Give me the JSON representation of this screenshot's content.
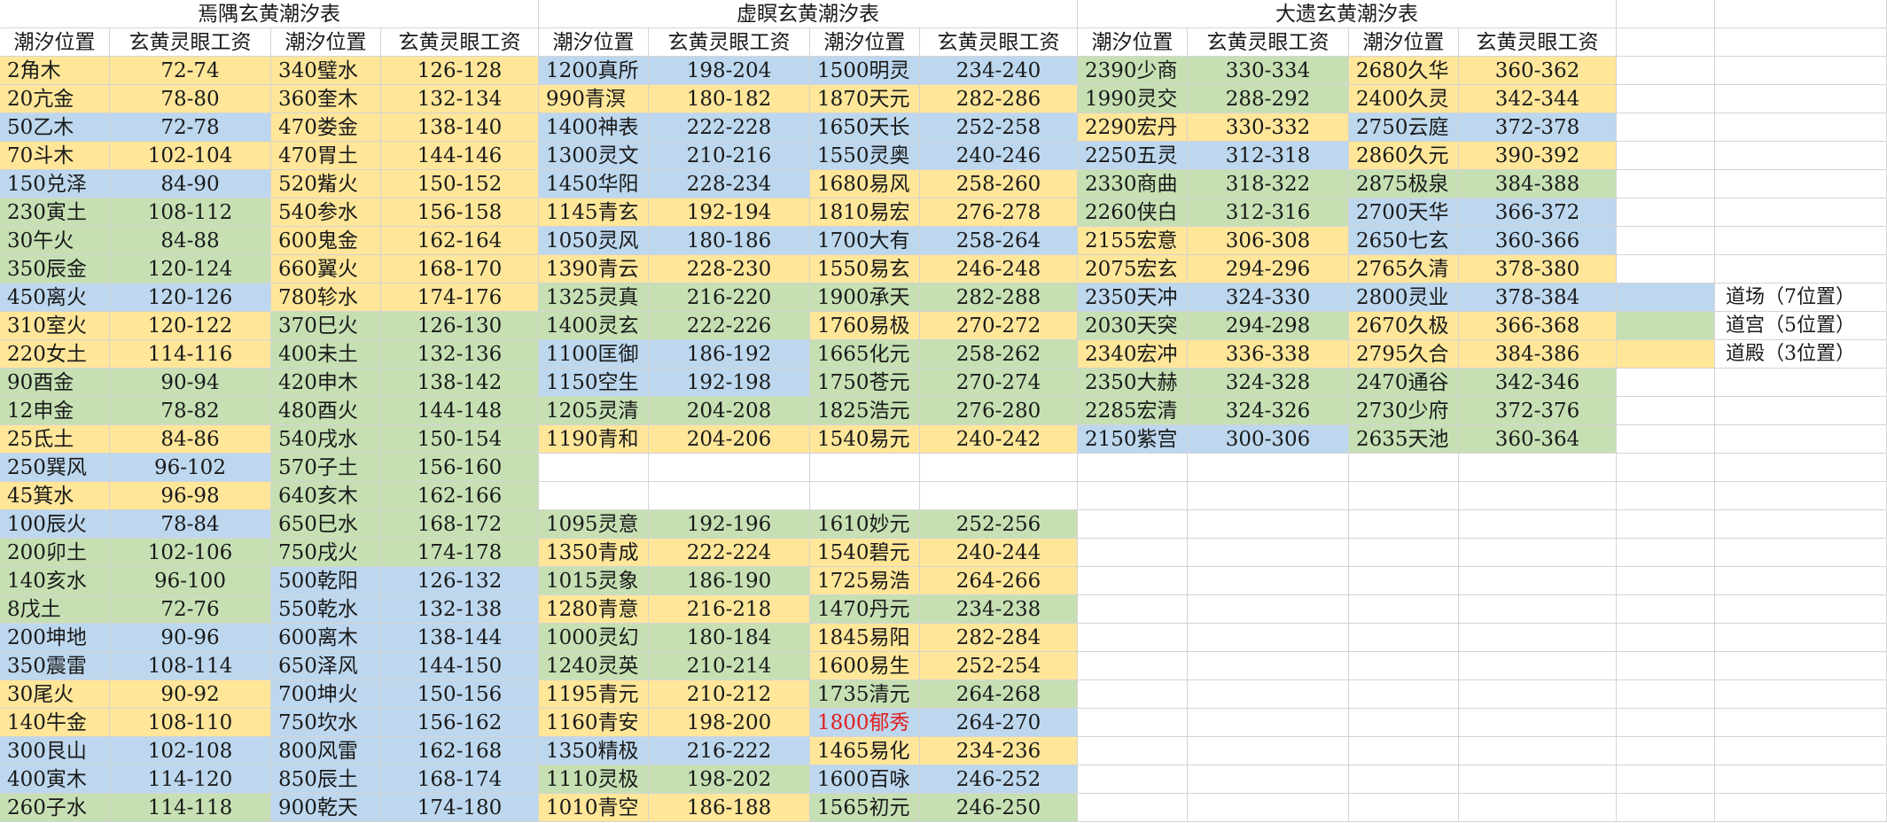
{
  "colors": {
    "Y": "#ffe699",
    "B": "#bdd7ee",
    "G": "#c6e0b4",
    "red_text": "#e02020"
  },
  "tables": [
    {
      "title": "焉隅玄黄潮汐表",
      "headers": [
        "潮汐位置",
        "玄黄灵眼工资",
        "潮汐位置",
        "玄黄灵眼工资"
      ],
      "rows": [
        [
          [
            "2角木",
            "72-74",
            "Y"
          ],
          [
            "340璧水",
            "126-128",
            "Y"
          ]
        ],
        [
          [
            "20亢金",
            "78-80",
            "Y"
          ],
          [
            "360奎木",
            "132-134",
            "Y"
          ]
        ],
        [
          [
            "50乙木",
            "72-78",
            "B"
          ],
          [
            "470娄金",
            "138-140",
            "Y"
          ]
        ],
        [
          [
            "70斗木",
            "102-104",
            "Y"
          ],
          [
            "470胃土",
            "144-146",
            "Y"
          ]
        ],
        [
          [
            "150兑泽",
            "84-90",
            "B"
          ],
          [
            "520觜火",
            "150-152",
            "Y"
          ]
        ],
        [
          [
            "230寅土",
            "108-112",
            "G"
          ],
          [
            "540参水",
            "156-158",
            "Y"
          ]
        ],
        [
          [
            "30午火",
            "84-88",
            "G"
          ],
          [
            "600鬼金",
            "162-164",
            "Y"
          ]
        ],
        [
          [
            "350辰金",
            "120-124",
            "G"
          ],
          [
            "660翼火",
            "168-170",
            "Y"
          ]
        ],
        [
          [
            "450离火",
            "120-126",
            "B"
          ],
          [
            "780轸水",
            "174-176",
            "Y"
          ]
        ],
        [
          [
            "310室火",
            "120-122",
            "Y"
          ],
          [
            "370巳火",
            "126-130",
            "G"
          ]
        ],
        [
          [
            "220女土",
            "114-116",
            "Y"
          ],
          [
            "400未土",
            "132-136",
            "G"
          ]
        ],
        [
          [
            "90酉金",
            "90-94",
            "G"
          ],
          [
            "420申木",
            "138-142",
            "G"
          ]
        ],
        [
          [
            "12申金",
            "78-82",
            "G"
          ],
          [
            "480酉火",
            "144-148",
            "G"
          ]
        ],
        [
          [
            "25氐土",
            "84-86",
            "Y"
          ],
          [
            "540戌水",
            "150-154",
            "G"
          ]
        ],
        [
          [
            "250巽风",
            "96-102",
            "B"
          ],
          [
            "570子土",
            "156-160",
            "G"
          ]
        ],
        [
          [
            "45箕水",
            "96-98",
            "Y"
          ],
          [
            "640亥木",
            "162-166",
            "G"
          ]
        ],
        [
          [
            "100辰火",
            "78-84",
            "B"
          ],
          [
            "650巳水",
            "168-172",
            "G"
          ]
        ],
        [
          [
            "200卯土",
            "102-106",
            "G"
          ],
          [
            "750戌火",
            "174-178",
            "G"
          ]
        ],
        [
          [
            "140亥水",
            "96-100",
            "G"
          ],
          [
            "500乾阳",
            "126-132",
            "B"
          ]
        ],
        [
          [
            "8戊土",
            "72-76",
            "G"
          ],
          [
            "550乾水",
            "132-138",
            "B"
          ]
        ],
        [
          [
            "200坤地",
            "90-96",
            "B"
          ],
          [
            "600离木",
            "138-144",
            "B"
          ]
        ],
        [
          [
            "350震雷",
            "108-114",
            "B"
          ],
          [
            "650泽风",
            "144-150",
            "B"
          ]
        ],
        [
          [
            "30尾火",
            "90-92",
            "Y"
          ],
          [
            "700坤火",
            "150-156",
            "B"
          ]
        ],
        [
          [
            "140牛金",
            "108-110",
            "Y"
          ],
          [
            "750坎水",
            "156-162",
            "B"
          ]
        ],
        [
          [
            "300艮山",
            "102-108",
            "B"
          ],
          [
            "800风雷",
            "162-168",
            "B"
          ]
        ],
        [
          [
            "400寅木",
            "114-120",
            "B"
          ],
          [
            "850辰土",
            "168-174",
            "B"
          ]
        ],
        [
          [
            "260子水",
            "114-118",
            "G"
          ],
          [
            "900乾天",
            "174-180",
            "B"
          ]
        ]
      ]
    },
    {
      "title": "虚瞑玄黄潮汐表",
      "headers": [
        "潮汐位置",
        "玄黄灵眼工资",
        "潮汐位置",
        "玄黄灵眼工资"
      ],
      "rows": [
        [
          [
            "1200真所",
            "198-204",
            "B"
          ],
          [
            "1500明灵",
            "234-240",
            "B"
          ]
        ],
        [
          [
            "990青溟",
            "180-182",
            "Y"
          ],
          [
            "1870天元",
            "282-286",
            "Y"
          ]
        ],
        [
          [
            "1400神表",
            "222-228",
            "B"
          ],
          [
            "1650天长",
            "252-258",
            "B"
          ]
        ],
        [
          [
            "1300灵文",
            "210-216",
            "B"
          ],
          [
            "1550灵奥",
            "240-246",
            "B"
          ]
        ],
        [
          [
            "1450华阳",
            "228-234",
            "B"
          ],
          [
            "1680易风",
            "258-260",
            "Y"
          ]
        ],
        [
          [
            "1145青玄",
            "192-194",
            "Y"
          ],
          [
            "1810易宏",
            "276-278",
            "Y"
          ]
        ],
        [
          [
            "1050灵风",
            "180-186",
            "B"
          ],
          [
            "1700大有",
            "258-264",
            "B"
          ]
        ],
        [
          [
            "1390青云",
            "228-230",
            "Y"
          ],
          [
            "1550易玄",
            "246-248",
            "Y"
          ]
        ],
        [
          [
            "1325灵真",
            "216-220",
            "G"
          ],
          [
            "1900承天",
            "282-288",
            "G"
          ]
        ],
        [
          [
            "1400灵玄",
            "222-226",
            "G"
          ],
          [
            "1760易极",
            "270-272",
            "Y"
          ]
        ],
        [
          [
            "1100匡御",
            "186-192",
            "B"
          ],
          [
            "1665化元",
            "258-262",
            "G"
          ]
        ],
        [
          [
            "1150空生",
            "192-198",
            "B"
          ],
          [
            "1750苍元",
            "270-274",
            "G"
          ]
        ],
        [
          [
            "1205灵清",
            "204-208",
            "G"
          ],
          [
            "1825浩元",
            "276-280",
            "G"
          ]
        ],
        [
          [
            "1190青和",
            "204-206",
            "Y"
          ],
          [
            "1540易元",
            "240-242",
            "Y"
          ]
        ],
        null,
        null,
        [
          [
            "1095灵意",
            "192-196",
            "G"
          ],
          [
            "1610妙元",
            "252-256",
            "G"
          ]
        ],
        [
          [
            "1350青成",
            "222-224",
            "Y"
          ],
          [
            "1540碧元",
            "240-244",
            "Y"
          ]
        ],
        [
          [
            "1015灵象",
            "186-190",
            "G"
          ],
          [
            "1725易浩",
            "264-266",
            "Y"
          ]
        ],
        [
          [
            "1280青意",
            "216-218",
            "Y"
          ],
          [
            "1470丹元",
            "234-238",
            "G"
          ]
        ],
        [
          [
            "1000灵幻",
            "180-184",
            "G"
          ],
          [
            "1845易阳",
            "282-284",
            "Y"
          ]
        ],
        [
          [
            "1240灵英",
            "210-214",
            "G"
          ],
          [
            "1600易生",
            "252-254",
            "Y"
          ]
        ],
        [
          [
            "1195青元",
            "210-212",
            "Y"
          ],
          [
            "1735清元",
            "264-268",
            "G"
          ]
        ],
        [
          [
            "1160青安",
            "198-200",
            "Y"
          ],
          [
            "1800郁秀",
            "264-270",
            "B",
            "red"
          ]
        ],
        [
          [
            "1350精极",
            "216-222",
            "B"
          ],
          [
            "1465易化",
            "234-236",
            "Y"
          ]
        ],
        [
          [
            "1110灵极",
            "198-202",
            "G"
          ],
          [
            "1600百咏",
            "246-252",
            "B"
          ]
        ],
        [
          [
            "1010青空",
            "186-188",
            "Y"
          ],
          [
            "1565初元",
            "246-250",
            "G"
          ]
        ]
      ]
    },
    {
      "title": "大遗玄黄潮汐表",
      "headers": [
        "潮汐位置",
        "玄黄灵眼工资",
        "潮汐位置",
        "玄黄灵眼工资"
      ],
      "rows": [
        [
          [
            "2390少商",
            "330-334",
            "G"
          ],
          [
            "2680久华",
            "360-362",
            "Y"
          ]
        ],
        [
          [
            "1990灵交",
            "288-292",
            "G"
          ],
          [
            "2400久灵",
            "342-344",
            "Y"
          ]
        ],
        [
          [
            "2290宏丹",
            "330-332",
            "Y"
          ],
          [
            "2750云庭",
            "372-378",
            "B"
          ]
        ],
        [
          [
            "2250五灵",
            "312-318",
            "B"
          ],
          [
            "2860久元",
            "390-392",
            "Y"
          ]
        ],
        [
          [
            "2330商曲",
            "318-322",
            "G"
          ],
          [
            "2875极泉",
            "384-388",
            "G"
          ]
        ],
        [
          [
            "2260侠白",
            "312-316",
            "G"
          ],
          [
            "2700天华",
            "366-372",
            "B"
          ]
        ],
        [
          [
            "2155宏意",
            "306-308",
            "Y"
          ],
          [
            "2650七玄",
            "360-366",
            "B"
          ]
        ],
        [
          [
            "2075宏玄",
            "294-296",
            "Y"
          ],
          [
            "2765久清",
            "378-380",
            "Y"
          ]
        ],
        [
          [
            "2350天冲",
            "324-330",
            "B"
          ],
          [
            "2800灵业",
            "378-384",
            "B"
          ]
        ],
        [
          [
            "2030天突",
            "294-298",
            "G"
          ],
          [
            "2670久极",
            "366-368",
            "Y"
          ]
        ],
        [
          [
            "2340宏冲",
            "336-338",
            "Y"
          ],
          [
            "2795久合",
            "384-386",
            "Y"
          ]
        ],
        [
          [
            "2350大赫",
            "324-328",
            "G"
          ],
          [
            "2470通谷",
            "342-346",
            "G"
          ]
        ],
        [
          [
            "2285宏清",
            "324-326",
            "G"
          ],
          [
            "2730少府",
            "372-376",
            "G"
          ]
        ],
        [
          [
            "2150紫宫",
            "300-306",
            "B"
          ],
          [
            "2635天池",
            "360-364",
            "G"
          ]
        ]
      ]
    }
  ],
  "legend": [
    {
      "color": "B",
      "label": "道场（7位置）"
    },
    {
      "color": "G",
      "label": "道宫（5位置）"
    },
    {
      "color": "Y",
      "label": "道殿（3位置）"
    }
  ]
}
